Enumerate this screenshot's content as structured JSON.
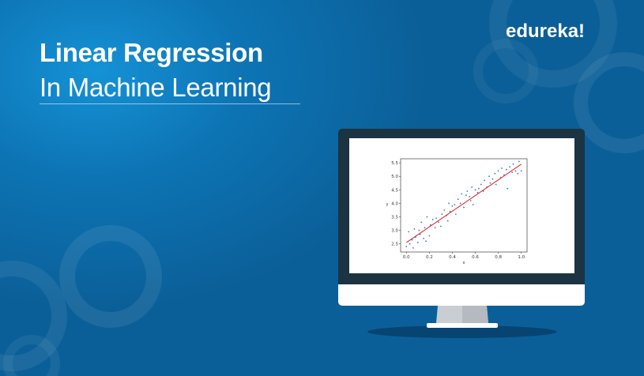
{
  "title": {
    "line1": "Linear Regression",
    "line2": "In Machine Learning"
  },
  "brand": {
    "name": "edureka!"
  },
  "colors": {
    "background": "#0b5f98",
    "accent": "#1592d6",
    "points": "#3a78b0",
    "fit_line": "#e02020"
  },
  "chart_data": {
    "type": "scatter",
    "title": "",
    "xlabel": "x",
    "ylabel": "y",
    "xlim": [
      -0.05,
      1.05
    ],
    "ylim": [
      2.2,
      5.65
    ],
    "x_ticks": [
      "0.0",
      "0.2",
      "0.4",
      "0.6",
      "0.8",
      "1.0"
    ],
    "y_ticks": [
      "2.5",
      "3.0",
      "3.5",
      "4.0",
      "4.5",
      "5.0",
      "5.5"
    ],
    "grid": false,
    "fit_line": {
      "x": [
        0.0,
        1.0
      ],
      "y": [
        2.55,
        5.45
      ]
    },
    "points": [
      [
        0.0,
        2.4
      ],
      [
        0.02,
        2.95
      ],
      [
        0.03,
        2.5
      ],
      [
        0.05,
        2.65
      ],
      [
        0.07,
        3.05
      ],
      [
        0.08,
        2.75
      ],
      [
        0.1,
        2.55
      ],
      [
        0.11,
        3.0
      ],
      [
        0.12,
        2.85
      ],
      [
        0.13,
        3.3
      ],
      [
        0.15,
        2.7
      ],
      [
        0.16,
        3.1
      ],
      [
        0.18,
        3.5
      ],
      [
        0.2,
        2.8
      ],
      [
        0.21,
        3.2
      ],
      [
        0.23,
        3.4
      ],
      [
        0.25,
        3.1
      ],
      [
        0.26,
        3.45
      ],
      [
        0.28,
        3.3
      ],
      [
        0.3,
        3.15
      ],
      [
        0.31,
        3.6
      ],
      [
        0.33,
        3.75
      ],
      [
        0.35,
        3.55
      ],
      [
        0.37,
        4.0
      ],
      [
        0.38,
        3.7
      ],
      [
        0.4,
        3.9
      ],
      [
        0.42,
        3.95
      ],
      [
        0.43,
        3.6
      ],
      [
        0.45,
        4.15
      ],
      [
        0.47,
        4.0
      ],
      [
        0.48,
        4.35
      ],
      [
        0.5,
        3.85
      ],
      [
        0.52,
        4.3
      ],
      [
        0.53,
        4.45
      ],
      [
        0.55,
        4.25
      ],
      [
        0.57,
        4.6
      ],
      [
        0.58,
        3.95
      ],
      [
        0.6,
        4.5
      ],
      [
        0.62,
        4.4
      ],
      [
        0.63,
        4.55
      ],
      [
        0.65,
        4.7
      ],
      [
        0.67,
        4.45
      ],
      [
        0.68,
        4.85
      ],
      [
        0.7,
        4.6
      ],
      [
        0.72,
        5.0
      ],
      [
        0.73,
        4.75
      ],
      [
        0.75,
        4.9
      ],
      [
        0.77,
        5.1
      ],
      [
        0.78,
        4.7
      ],
      [
        0.8,
        5.2
      ],
      [
        0.82,
        4.95
      ],
      [
        0.83,
        5.3
      ],
      [
        0.85,
        5.05
      ],
      [
        0.87,
        5.25
      ],
      [
        0.88,
        4.55
      ],
      [
        0.9,
        5.35
      ],
      [
        0.92,
        5.15
      ],
      [
        0.93,
        5.45
      ],
      [
        0.95,
        5.2
      ],
      [
        0.97,
        5.1
      ],
      [
        0.98,
        5.55
      ],
      [
        1.0,
        5.2
      ],
      [
        0.06,
        2.35
      ],
      [
        0.17,
        2.6
      ],
      [
        0.36,
        3.35
      ],
      [
        0.56,
        4.1
      ]
    ]
  }
}
